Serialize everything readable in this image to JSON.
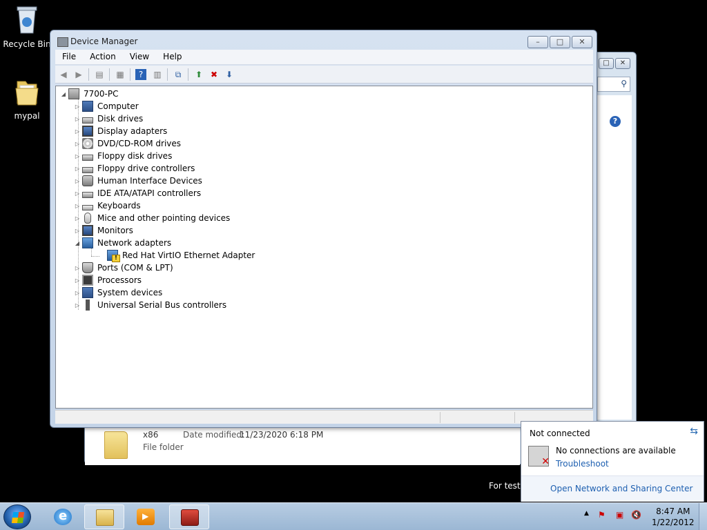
{
  "desktop": {
    "icons": [
      {
        "label": "Recycle Bin",
        "icon": "recycle-bin-icon"
      },
      {
        "label": "mypal",
        "icon": "folder-icon"
      }
    ],
    "watermark": "For testin"
  },
  "background_window": {
    "file": {
      "name": "x86",
      "type": "File folder",
      "date_label": "Date modified:",
      "date": "11/23/2020 6:18 PM"
    }
  },
  "device_manager": {
    "title": "Device Manager",
    "menu": [
      "File",
      "Action",
      "View",
      "Help"
    ],
    "root": "7700-PC",
    "categories": [
      {
        "label": "Computer",
        "icon": "computer-icon"
      },
      {
        "label": "Disk drives",
        "icon": "disk-icon"
      },
      {
        "label": "Display adapters",
        "icon": "monitor-icon"
      },
      {
        "label": "DVD/CD-ROM drives",
        "icon": "cd-icon"
      },
      {
        "label": "Floppy disk drives",
        "icon": "disk-icon"
      },
      {
        "label": "Floppy drive controllers",
        "icon": "disk-icon"
      },
      {
        "label": "Human Interface Devices",
        "icon": "hid-icon"
      },
      {
        "label": "IDE ATA/ATAPI controllers",
        "icon": "disk-icon"
      },
      {
        "label": "Keyboards",
        "icon": "keyboard-icon"
      },
      {
        "label": "Mice and other pointing devices",
        "icon": "mouse-icon"
      },
      {
        "label": "Monitors",
        "icon": "monitor-icon"
      },
      {
        "label": "Network adapters",
        "icon": "network-icon",
        "expanded": true
      },
      {
        "label": "Red Hat VirtIO Ethernet Adapter",
        "icon": "network-warning-icon",
        "child": true
      },
      {
        "label": "Ports (COM & LPT)",
        "icon": "port-icon"
      },
      {
        "label": "Processors",
        "icon": "cpu-icon"
      },
      {
        "label": "System devices",
        "icon": "computer-icon"
      },
      {
        "label": "Universal Serial Bus controllers",
        "icon": "usb-icon"
      }
    ]
  },
  "network_flyout": {
    "title": "Not connected",
    "message": "No connections are available",
    "troubleshoot": "Troubleshoot",
    "footer_link": "Open Network and Sharing Center"
  },
  "taskbar": {
    "time": "8:47 AM",
    "date": "1/22/2012"
  }
}
